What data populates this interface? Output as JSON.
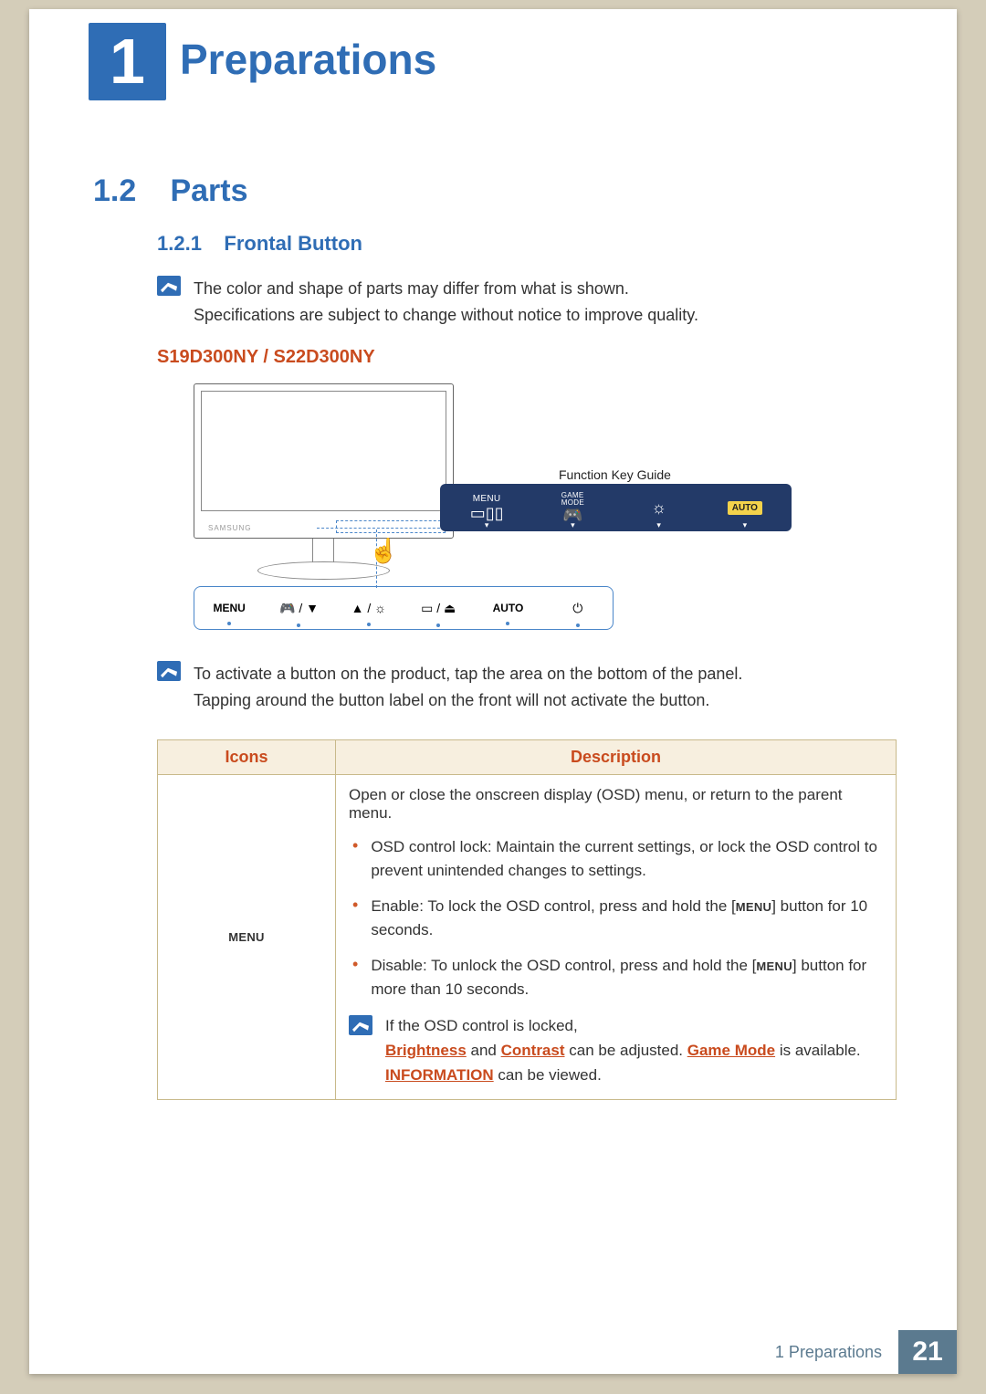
{
  "chapter": {
    "number": "1",
    "title": "Preparations"
  },
  "section": {
    "number": "1.2",
    "title": "Parts"
  },
  "subsection": {
    "number": "1.2.1",
    "title": "Frontal Button"
  },
  "note1": {
    "line1": "The color and shape of parts may differ from what is shown.",
    "line2": "Specifications are subject to change without notice to improve quality."
  },
  "model_heading": "S19D300NY / S22D300NY",
  "diagram": {
    "monitor_brand": "SAMSUNG",
    "function_key_guide_label": "Function Key Guide",
    "fkg_items": [
      {
        "top": "MENU",
        "icon": "▭▯▯",
        "arrow": "▾"
      },
      {
        "top": "GAME MODE",
        "icon": "🎮",
        "arrow": "▾"
      },
      {
        "top": "",
        "icon": "☼",
        "arrow": "▾"
      },
      {
        "top": "",
        "icon": "AUTO",
        "arrow": "▾",
        "auto": true
      }
    ],
    "button_strip": [
      {
        "label": "MENU",
        "type": "text"
      },
      {
        "label": "🎮 / ▼",
        "type": "combo"
      },
      {
        "label": "▲ / ☼",
        "type": "combo"
      },
      {
        "label": "▭ / ⏏",
        "type": "combo"
      },
      {
        "label": "AUTO",
        "type": "text"
      },
      {
        "label": "⏻",
        "type": "power"
      }
    ]
  },
  "note2": {
    "line1": "To activate a button on the product, tap the area on the bottom of the panel.",
    "line2": "Tapping around the button label on the front will not activate the button."
  },
  "table": {
    "headers": {
      "icons": "Icons",
      "description": "Description"
    },
    "row1": {
      "icon_label": "MENU",
      "intro": "Open or close the onscreen display (OSD) menu, or return to the parent menu.",
      "b1": "OSD control lock: Maintain the current settings, or lock the OSD control to prevent unintended changes to settings.",
      "b2_pre": "Enable: To lock the OSD control, press and hold the [",
      "b2_menu": "MENU",
      "b2_post": "] button for 10 seconds.",
      "b3_pre": "Disable: To unlock the OSD control, press and hold the [",
      "b3_menu": "MENU",
      "b3_post": "] button for more than 10 seconds.",
      "inner_note_line1": "If the OSD control is locked,",
      "inner_note_brightness": "Brightness",
      "inner_note_and": " and ",
      "inner_note_contrast": "Contrast",
      "inner_note_mid": " can be adjusted. ",
      "inner_note_gamemode": "Game Mode",
      "inner_note_tail": " is available. ",
      "inner_note_information": "INFORMATION",
      "inner_note_end": " can be viewed."
    }
  },
  "footer": {
    "label": "1 Preparations",
    "page": "21"
  }
}
